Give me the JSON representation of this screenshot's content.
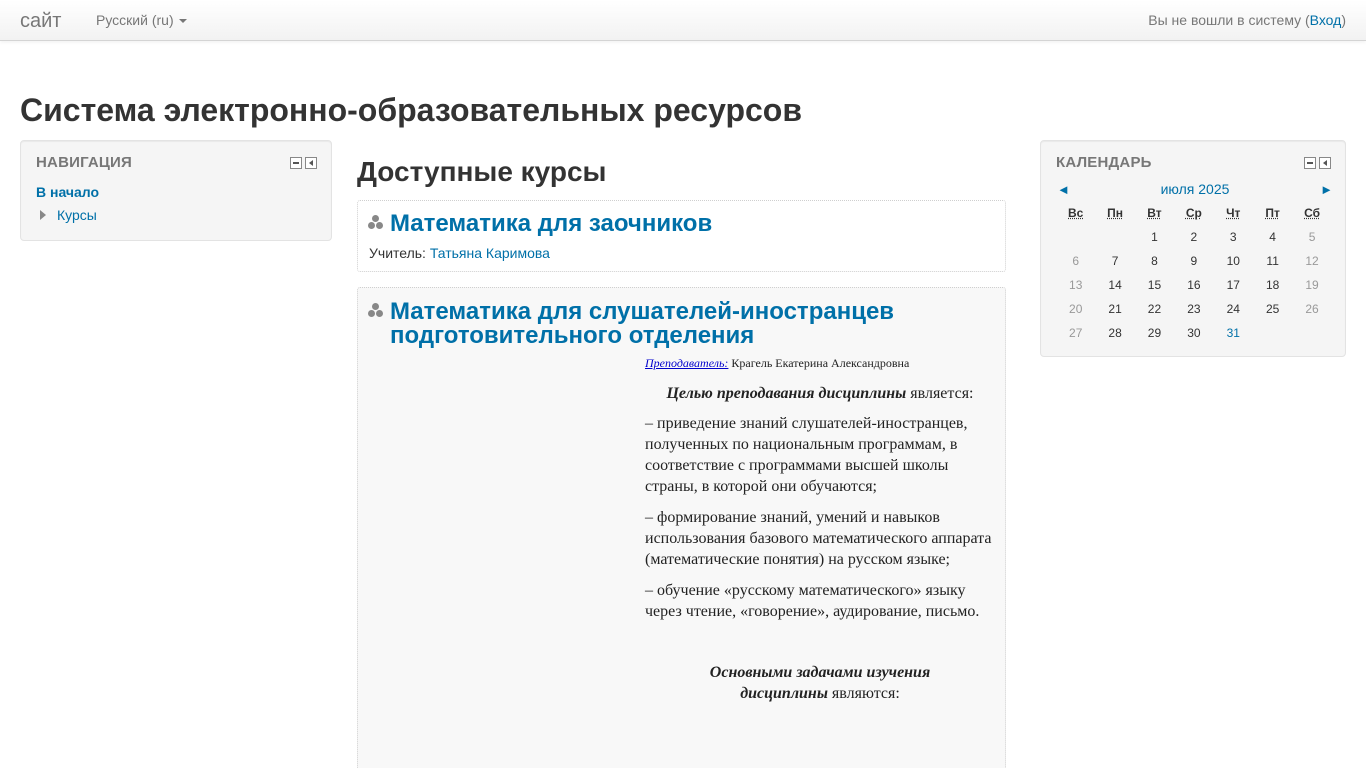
{
  "navbar": {
    "brand": "сайт",
    "language": "Русский (ru)",
    "login_text": "Вы не вошли в систему (",
    "login_link": "Вход",
    "login_close": ")"
  },
  "page_header": "Система электронно-образовательных ресурсов",
  "navigation_block": {
    "title": "НАВИГАЦИЯ",
    "home": "В начало",
    "courses": "Курсы"
  },
  "main": {
    "heading": "Доступные курсы",
    "courses": [
      {
        "title": "Математика для заочников",
        "teacher_label": "Учитель: ",
        "teacher_name": "Татьяна Каримова"
      },
      {
        "title_line1": "Математика для слушателей-иностранцев",
        "title_line2": "подготовительного отделения",
        "summary": {
          "teacher_label": "Преподаватель:",
          "teacher_name": " Крагель Екатерина Александровна",
          "goal_bold": "Целью преподавания дисциплины",
          "goal_rest": " является:",
          "item1": "– приведение знаний слушателей-иностранцев, полученных по национальным программам, в соответствие с программами высшей школы страны, в которой они обучаются;",
          "item2": "– формирование знаний, умений и навыков использования базового математического аппарата (математические понятия) на русском языке;",
          "item3": "– обучение «русскому математического» языку через чтение, «говорение», аудирование, письмо.",
          "tasks_bold_1": "Основными задачами изучения",
          "tasks_bold_2": "дисциплины",
          "tasks_rest": " являются:"
        }
      }
    ]
  },
  "calendar": {
    "title": "КАЛЕНДАРЬ",
    "month": "июля 2025",
    "prev": "◄",
    "next": "►",
    "weekdays": [
      "Вс",
      "Пн",
      "Вт",
      "Ср",
      "Чт",
      "Пт",
      "Сб"
    ],
    "weeks": [
      [
        "",
        "",
        "1",
        "2",
        "3",
        "4",
        "5"
      ],
      [
        "6",
        "7",
        "8",
        "9",
        "10",
        "11",
        "12"
      ],
      [
        "13",
        "14",
        "15",
        "16",
        "17",
        "18",
        "19"
      ],
      [
        "20",
        "21",
        "22",
        "23",
        "24",
        "25",
        "26"
      ],
      [
        "27",
        "28",
        "29",
        "30",
        "31",
        "",
        ""
      ]
    ],
    "today": "31"
  },
  "colors": {
    "link": "#0070a8",
    "text": "#333333",
    "muted": "#777777"
  }
}
